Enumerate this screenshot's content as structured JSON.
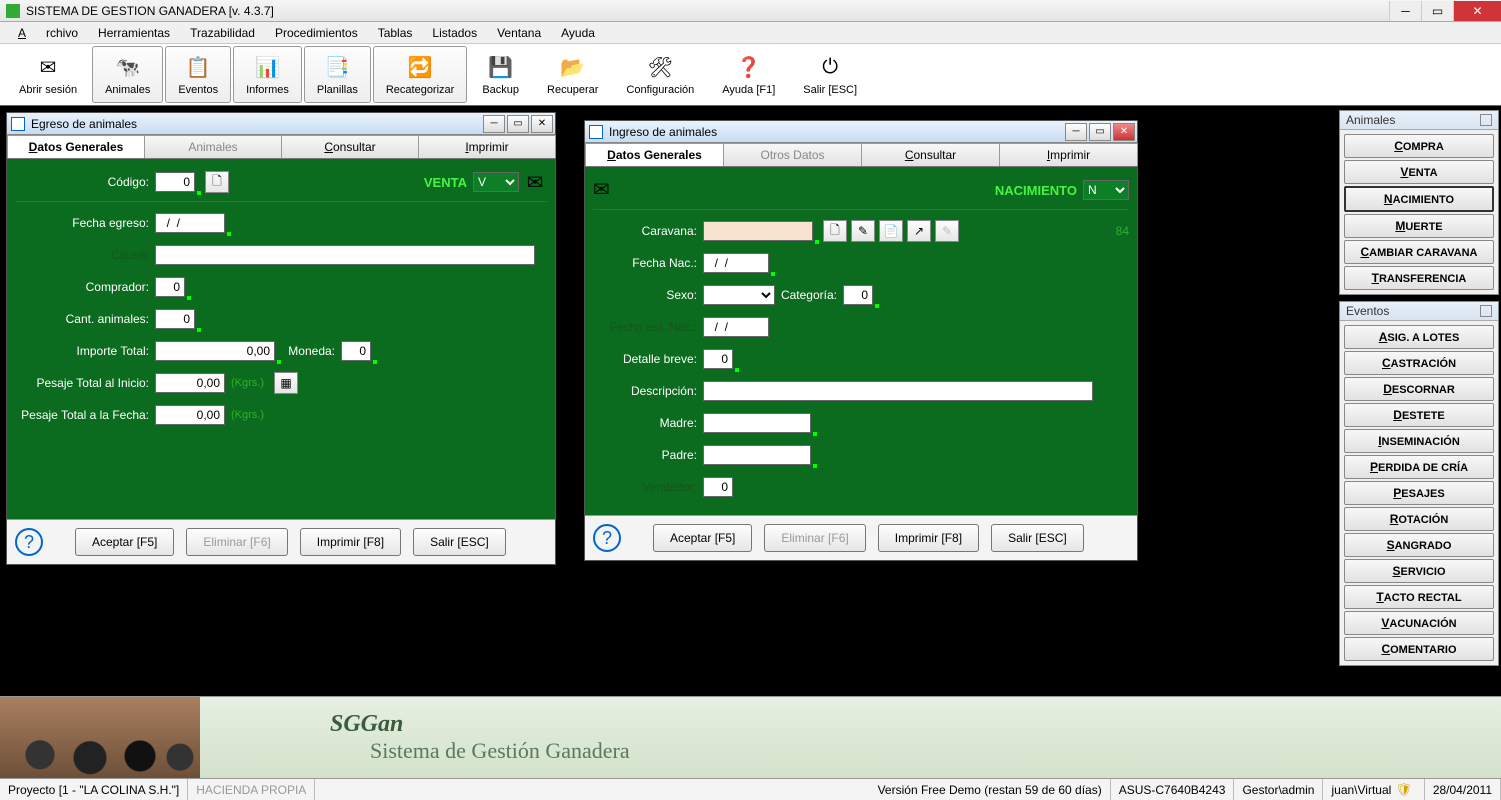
{
  "app": {
    "title": "SISTEMA DE GESTION GANADERA [v. 4.3.7]"
  },
  "menu": [
    "Archivo",
    "Herramientas",
    "Trazabilidad",
    "Procedimientos",
    "Tablas",
    "Listados",
    "Ventana",
    "Ayuda"
  ],
  "toolbar": [
    {
      "label": "Abrir sesión",
      "icon": "✉"
    },
    {
      "label": "Animales",
      "icon": "🐄"
    },
    {
      "label": "Eventos",
      "icon": "📋"
    },
    {
      "label": "Informes",
      "icon": "📊"
    },
    {
      "label": "Planillas",
      "icon": "📑"
    },
    {
      "label": "Recategorizar",
      "icon": "🔁"
    },
    {
      "label": "Backup",
      "icon": "💾"
    },
    {
      "label": "Recuperar",
      "icon": "📂"
    },
    {
      "label": "Configuración",
      "icon": "🛠"
    },
    {
      "label": "Ayuda [F1]",
      "icon": "❓"
    },
    {
      "label": "Salir [ESC]",
      "icon": "⏻"
    }
  ],
  "egreso": {
    "title": "Egreso de animales",
    "tabs": [
      "Datos Generales",
      "Animales",
      "Consultar",
      "Imprimir"
    ],
    "codigo_label": "Código:",
    "codigo_value": "0",
    "venta_label": "VENTA",
    "venta_sel": "V",
    "fecha_label": "Fecha egreso:",
    "fecha_value": "  /  /",
    "causa_label": "Causa:",
    "comprador_label": "Comprador:",
    "comprador_value": "0",
    "cant_label": "Cant. animales:",
    "cant_value": "0",
    "importe_label": "Importe Total:",
    "importe_value": "0,00",
    "moneda_label": "Moneda:",
    "moneda_value": "0",
    "pesaje_inicio_label": "Pesaje Total al Inicio:",
    "pesaje_inicio_value": "0,00",
    "pesaje_fecha_label": "Pesaje Total a la Fecha:",
    "pesaje_fecha_value": "0,00",
    "kgrs": "(Kgrs.)",
    "buttons": {
      "aceptar": "Aceptar [F5]",
      "eliminar": "Eliminar [F6]",
      "imprimir": "Imprimir [F8]",
      "salir": "Salir [ESC]"
    }
  },
  "ingreso": {
    "title": "Ingreso de animales",
    "tabs": [
      "Datos Generales",
      "Otros Datos",
      "Consultar",
      "Imprimir"
    ],
    "nacimiento_label": "NACIMIENTO",
    "nac_sel": "N",
    "count": "84",
    "caravana_label": "Caravana:",
    "fechanac_label": "Fecha Nac.:",
    "fechanac_value": "  /  /",
    "sexo_label": "Sexo:",
    "categoria_label": "Categoría:",
    "categoria_value": "0",
    "fechaest_label": "Fecha est. Nac.:",
    "fechaest_value": "  /  /",
    "detalle_label": "Detalle breve:",
    "detalle_value": "0",
    "desc_label": "Descripción:",
    "madre_label": "Madre:",
    "padre_label": "Padre:",
    "vendedor_label": "Vendedor:",
    "vendedor_value": "0",
    "buttons": {
      "aceptar": "Aceptar [F5]",
      "eliminar": "Eliminar [F6]",
      "imprimir": "Imprimir [F8]",
      "salir": "Salir [ESC]"
    }
  },
  "right_animales": {
    "title": "Animales",
    "items": [
      "COMPRA",
      "VENTA",
      "NACIMIENTO",
      "MUERTE",
      "CAMBIAR CARAVANA",
      "TRANSFERENCIA"
    ],
    "selected": 2
  },
  "right_eventos": {
    "title": "Eventos",
    "items": [
      "ASIG. A LOTES",
      "CASTRACIÓN",
      "DESCORNAR",
      "DESTETE",
      "INSEMINACIÓN",
      "PERDIDA DE CRÍA",
      "PESAJES",
      "ROTACIÓN",
      "SANGRADO",
      "SERVICIO",
      "TACTO RECTAL",
      "VACUNACIÓN",
      "COMENTARIO"
    ]
  },
  "banner": {
    "t1": "SGGan",
    "t2": "Sistema de Gestión Ganadera"
  },
  "status": {
    "proyecto": "Proyecto  [1 - \"LA COLINA S.H.\"]",
    "hacienda": "HACIENDA PROPIA",
    "version": "Versión Free Demo (restan 59 de 60 días)",
    "host": "ASUS-C7640B4243",
    "gestor": "Gestor\\admin",
    "user": "juan\\Virtual",
    "date": "28/04/2011"
  }
}
